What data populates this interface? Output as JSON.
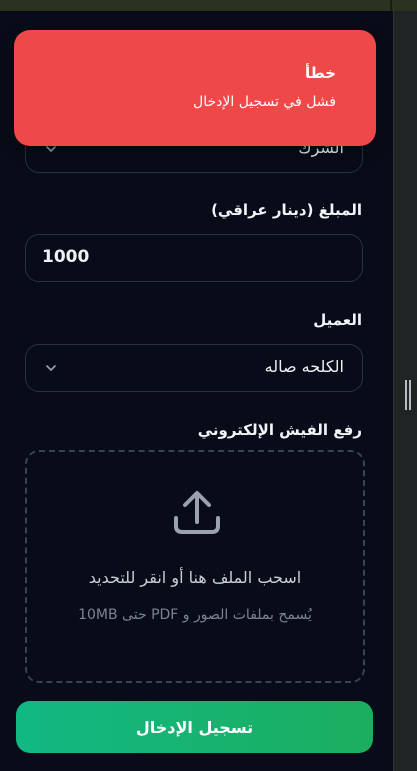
{
  "toast": {
    "title": "خطأ",
    "message": "فشل في تسجيل الإدخال"
  },
  "form": {
    "first_select_value": "الشرك",
    "amount_label": "المبلغ (دينار عراقي)",
    "amount_value": "1000",
    "client_label": "العميل",
    "client_value": "الكلحه صاله",
    "upload_label": "رفع الفيش الإلكتروني",
    "upload_main_text": "اسحب الملف هنا أو انقر للتحديد",
    "upload_sub_text": "يُسمح بملفات الصور و PDF حتى 10MB",
    "submit_label": "تسجيل الإدخال"
  },
  "icons": {
    "chevron": "chevron-down-icon",
    "upload": "upload-icon",
    "resize": "resize-handle-icon"
  },
  "colors": {
    "background": "#070c18",
    "toast": "#ef4848",
    "submit_start": "#11b883",
    "submit_end": "#1cae5f"
  }
}
